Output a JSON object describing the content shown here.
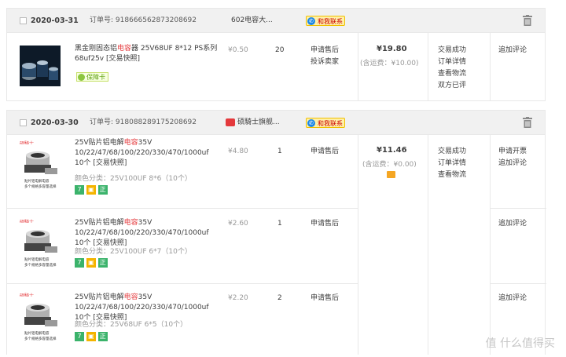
{
  "orders": [
    {
      "date": "2020-03-31",
      "order_label": "订单号:",
      "order_no": "918666562873208692",
      "shop": "602电容大...",
      "chat": "和我联系",
      "items": [
        {
          "title_pre": "黑金刚固态铝",
          "title_hl": "电容",
          "title_post": "器 25V68UF 8*12 PS系列 68uf25v [交易快照]",
          "tag": "保障卡",
          "price": "¥0.50",
          "qty": "20",
          "service": [
            "申请售后",
            "投诉卖家"
          ]
        }
      ],
      "total": "¥19.80",
      "shipping": "(含运费：¥10.00)",
      "status": [
        "交易成功",
        "订单详情",
        "查看物流",
        "双方已评"
      ],
      "actions_per_item": [
        [
          "追加评论"
        ]
      ]
    },
    {
      "date": "2020-03-30",
      "order_label": "订单号:",
      "order_no": "918088289175208692",
      "shop": "硕騎士旗舰...",
      "chat": "和我联系",
      "items": [
        {
          "title_pre": "25V贴片铝电解",
          "title_hl": "电容",
          "title_post": "35V 10/22/47/68/100/220/330/470/1000uf 10个 [交易快照]",
          "spec": "颜色分类：25V100UF 8*6（10个）",
          "price": "¥4.80",
          "qty": "1",
          "service": [
            "申请售后"
          ]
        },
        {
          "title_pre": "25V贴片铝电解",
          "title_hl": "电容",
          "title_post": "35V 10/22/47/68/100/220/330/470/1000uf 10个 [交易快照]",
          "spec": "颜色分类：25V100UF 6*7（10个）",
          "price": "¥2.60",
          "qty": "1",
          "service": [
            "申请售后"
          ]
        },
        {
          "title_pre": "25V贴片铝电解",
          "title_hl": "电容",
          "title_post": "35V 10/22/47/68/100/220/330/470/1000uf 10个 [交易快照]",
          "spec": "颜色分类：25V68UF 6*5（10个）",
          "price": "¥2.20",
          "qty": "2",
          "service": [
            "申请售后"
          ]
        }
      ],
      "total": "¥11.46",
      "shipping": "(含运费：¥0.00)",
      "status": [
        "交易成功",
        "订单详情",
        "查看物流"
      ],
      "actions_per_item": [
        [
          "申请开票",
          "追加评论"
        ],
        [
          "追加评论"
        ],
        [
          "追加评论"
        ]
      ]
    }
  ],
  "badges": {
    "seven": "7",
    "zheng": "正"
  },
  "product_img_caption": "贴片铝电解电容 多个规格多容量选择",
  "brand_mark": "硕騎士",
  "watermark": "值 什么值得买",
  "colors": {
    "accent_red": "#e4393c",
    "chat_bg": "#fff0a8",
    "header_bg": "#f1f1f1"
  }
}
